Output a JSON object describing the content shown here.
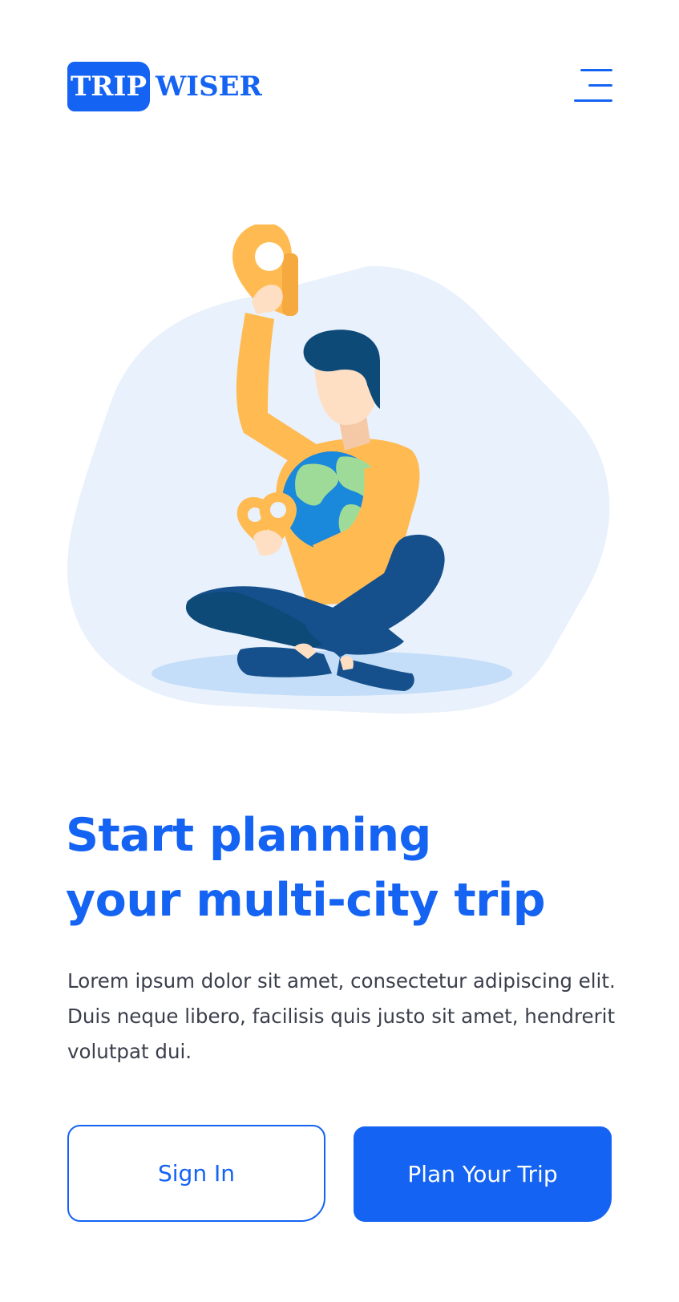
{
  "header": {
    "logo": {
      "part1": "TRIP",
      "part2": "WISER"
    },
    "menu_icon": "hamburger-menu-icon"
  },
  "hero": {
    "illustration": "person-holding-globe-and-location-pins-illustration",
    "colors": {
      "blob": "#e8f1fc",
      "shadow": "#c4ddf8",
      "sweater": "#ffbb52",
      "pants": "#15508c",
      "hair": "#0e4a78",
      "skin": "#ffdfc4",
      "ocean": "#1a88db",
      "land": "#9fdb98"
    }
  },
  "main": {
    "title_line1": "Start planning",
    "title_line2": "your multi-city trip",
    "description": "Lorem ipsum dolor sit amet, consectetur adipiscing elit. Duis neque libero, facilisis quis justo sit amet, hendrerit volutpat dui."
  },
  "actions": {
    "sign_in_label": "Sign In",
    "plan_label": "Plan Your Trip"
  },
  "theme": {
    "primary": "#1463f3",
    "text": "#3b3f4c",
    "background": "#ffffff"
  }
}
